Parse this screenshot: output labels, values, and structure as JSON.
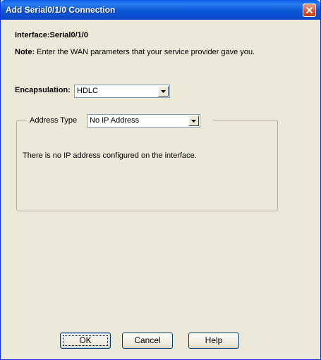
{
  "window": {
    "title": "Add Serial0/1/0 Connection"
  },
  "interface_line": "Interface:Serial0/1/0",
  "note": {
    "label": "Note:",
    "text": " Enter the WAN parameters that your service provider gave you."
  },
  "encapsulation": {
    "label": "Encapsulation:",
    "value": "HDLC"
  },
  "address_group": {
    "label": "Address Type",
    "value": "No IP Address",
    "message": "There is no IP address configured on the interface."
  },
  "buttons": {
    "ok": "OK",
    "cancel": "Cancel",
    "help": "Help"
  },
  "colors": {
    "titlebar": "#0b57d8",
    "close": "#d8512c",
    "face": "#ece9d8"
  }
}
